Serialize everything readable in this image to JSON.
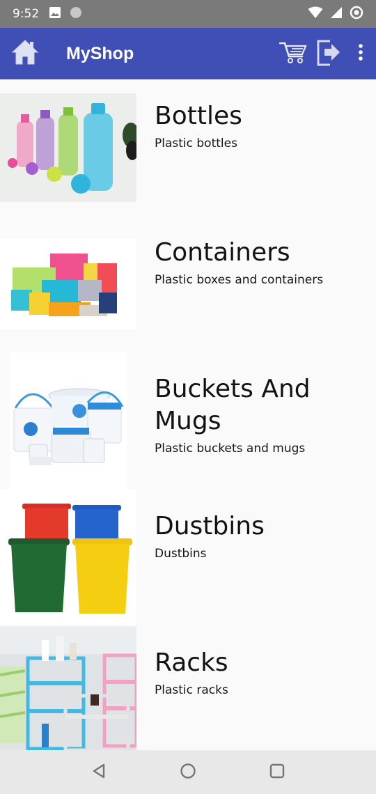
{
  "status_bar": {
    "time": "9:52",
    "icons": [
      "image-icon",
      "circle-icon",
      "wifi-icon",
      "signal-icon",
      "data-saver-icon"
    ]
  },
  "app_bar": {
    "title": "MyShop",
    "color": "#3f4fb5",
    "icons": [
      "home-icon",
      "cart-icon",
      "logout-icon",
      "more-vert-icon"
    ]
  },
  "categories": [
    {
      "name": "Bottles",
      "description": "Plastic bottles"
    },
    {
      "name": "Containers",
      "description": "Plastic boxes and containers"
    },
    {
      "name": "Buckets And Mugs",
      "description": "Plastic buckets and mugs"
    },
    {
      "name": "Dustbins",
      "description": "Dustbins"
    },
    {
      "name": "Racks",
      "description": "Plastic racks"
    }
  ],
  "nav_bar": {
    "icons": [
      "back-icon",
      "home-circle-icon",
      "recents-icon"
    ]
  }
}
